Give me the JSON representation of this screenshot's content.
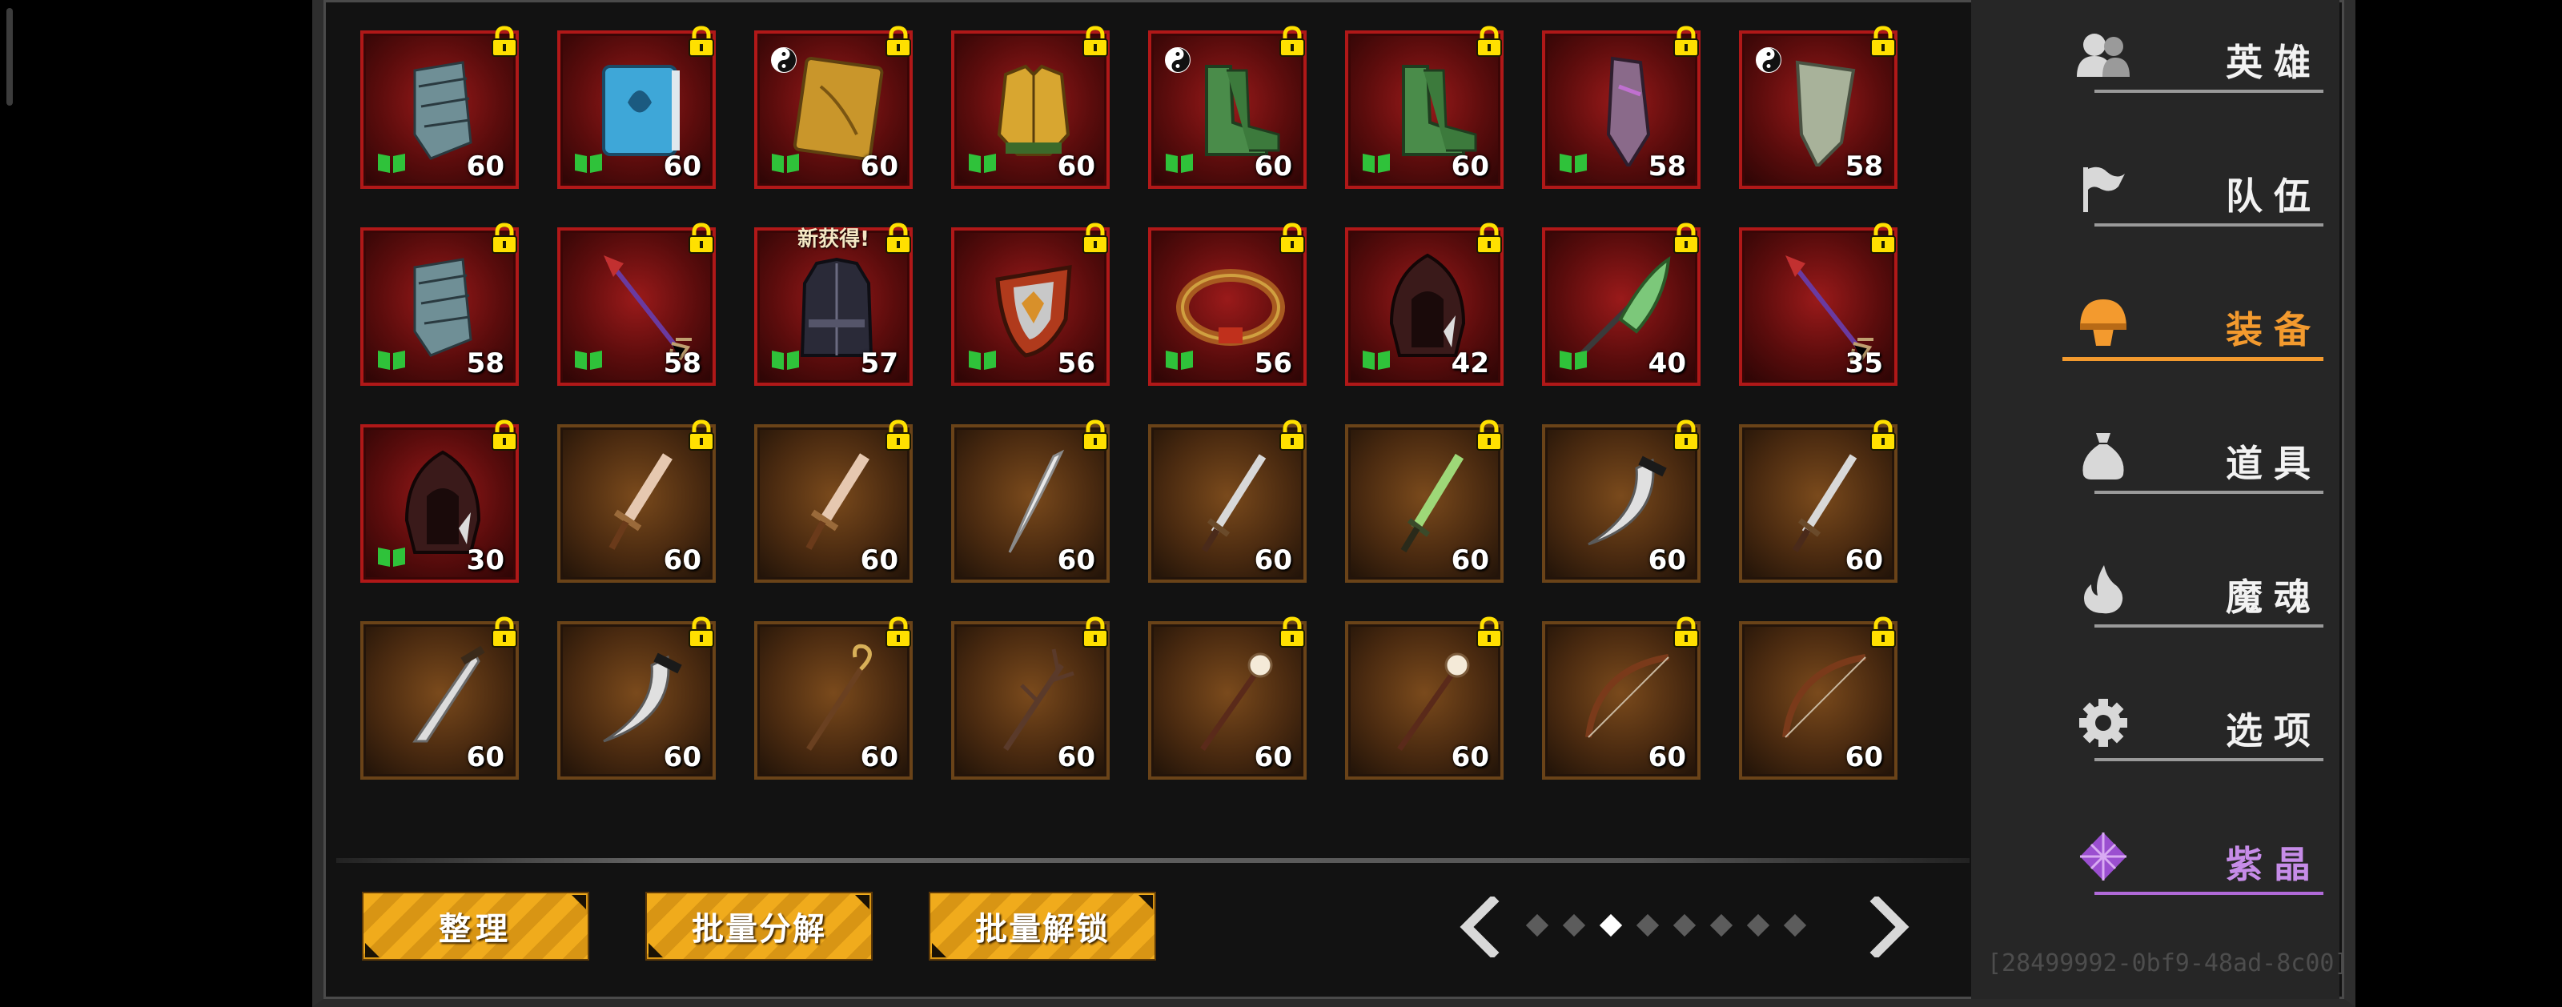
{
  "sidebar": {
    "items": [
      {
        "label": "英雄",
        "icon": "hero-icon"
      },
      {
        "label": "队伍",
        "icon": "flag-icon"
      },
      {
        "label": "装备",
        "icon": "helmet-icon",
        "active": true
      },
      {
        "label": "道具",
        "icon": "bag-icon"
      },
      {
        "label": "魔魂",
        "icon": "flame-icon"
      },
      {
        "label": "选项",
        "icon": "gear-icon"
      },
      {
        "label": "紫晶",
        "icon": "amethyst-icon"
      }
    ]
  },
  "toolbar": {
    "sort_label": "整理",
    "batch_dismantle_label": "批量分解",
    "batch_unlock_label": "批量解锁"
  },
  "pager": {
    "total_pages": 8,
    "current_page": 3
  },
  "new_tag": "新获得!",
  "build_id": "[28499992-0bf9-48ad-8c00]",
  "colors": {
    "accent": "#f39a2e",
    "button": "#f0ab1c",
    "set_border": "#b01818",
    "normal_border": "#6a4318",
    "purple": "#c68ce8"
  },
  "items": [
    {
      "level": "60",
      "icon": "gauntlet-icon",
      "rarity": "set",
      "book": true,
      "locked": true
    },
    {
      "level": "60",
      "icon": "spellbook-icon",
      "rarity": "set",
      "book": true,
      "locked": true
    },
    {
      "level": "60",
      "icon": "tome-icon",
      "rarity": "set",
      "book": true,
      "yinyang": true,
      "locked": true
    },
    {
      "level": "60",
      "icon": "chest-armor-icon",
      "rarity": "set",
      "book": true,
      "locked": true
    },
    {
      "level": "60",
      "icon": "boots-icon",
      "rarity": "set",
      "book": true,
      "yinyang": true,
      "locked": true
    },
    {
      "level": "60",
      "icon": "boots-icon",
      "rarity": "set",
      "book": true,
      "locked": true
    },
    {
      "level": "58",
      "icon": "bracer-icon",
      "rarity": "set",
      "book": true,
      "locked": true
    },
    {
      "level": "58",
      "icon": "leaf-bracer-icon",
      "rarity": "set",
      "yinyang": true,
      "locked": true
    },
    {
      "level": "58",
      "icon": "gauntlet-icon",
      "rarity": "set",
      "book": true,
      "locked": true
    },
    {
      "level": "58",
      "icon": "arrow-icon",
      "rarity": "set",
      "book": true,
      "locked": true
    },
    {
      "level": "57",
      "icon": "coat-icon",
      "rarity": "set",
      "book": true,
      "locked": true,
      "is_new": true
    },
    {
      "level": "56",
      "icon": "shield-icon",
      "rarity": "set",
      "book": true,
      "locked": true
    },
    {
      "level": "56",
      "icon": "belt-icon",
      "rarity": "set",
      "book": true,
      "locked": true
    },
    {
      "level": "42",
      "icon": "hood-icon",
      "rarity": "set",
      "book": true,
      "locked": true
    },
    {
      "level": "40",
      "icon": "glaive-icon",
      "rarity": "set",
      "book": true,
      "locked": true
    },
    {
      "level": "35",
      "icon": "arrow-icon",
      "rarity": "set",
      "locked": true
    },
    {
      "level": "30",
      "icon": "hood-icon",
      "rarity": "set",
      "book": true,
      "locked": true
    },
    {
      "level": "60",
      "icon": "sword-icon",
      "rarity": "normal",
      "locked": true
    },
    {
      "level": "60",
      "icon": "sword-icon",
      "rarity": "normal",
      "locked": true
    },
    {
      "level": "60",
      "icon": "blade-icon",
      "rarity": "normal",
      "locked": true
    },
    {
      "level": "60",
      "icon": "dagger-icon",
      "rarity": "normal",
      "locked": true
    },
    {
      "level": "60",
      "icon": "green-dagger-icon",
      "rarity": "normal",
      "locked": true
    },
    {
      "level": "60",
      "icon": "curved-blade-icon",
      "rarity": "normal",
      "locked": true
    },
    {
      "level": "60",
      "icon": "dagger-icon",
      "rarity": "normal",
      "locked": true
    },
    {
      "level": "60",
      "icon": "knife-icon",
      "rarity": "normal",
      "locked": true
    },
    {
      "level": "60",
      "icon": "curved-blade-icon",
      "rarity": "normal",
      "locked": true
    },
    {
      "level": "60",
      "icon": "staff-icon",
      "rarity": "normal",
      "locked": true
    },
    {
      "level": "60",
      "icon": "branch-staff-icon",
      "rarity": "normal",
      "locked": true
    },
    {
      "level": "60",
      "icon": "orb-staff-icon",
      "rarity": "normal",
      "locked": true
    },
    {
      "level": "60",
      "icon": "orb-staff-icon",
      "rarity": "normal",
      "locked": true
    },
    {
      "level": "60",
      "icon": "bow-icon",
      "rarity": "normal",
      "locked": true
    },
    {
      "level": "60",
      "icon": "bow-icon",
      "rarity": "normal",
      "locked": true
    }
  ]
}
